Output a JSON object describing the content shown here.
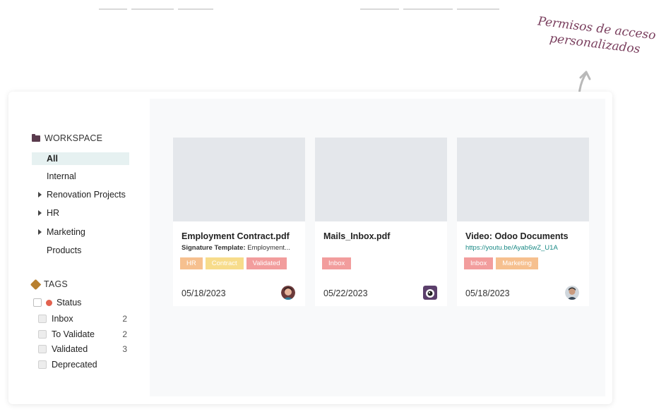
{
  "annotation": {
    "line1": "Permisos de acceso",
    "line2": "personalizados"
  },
  "workspace": {
    "title": "WORKSPACE",
    "items": [
      {
        "label": "All"
      },
      {
        "label": "Internal"
      },
      {
        "label": "Renovation Projects"
      },
      {
        "label": "HR"
      },
      {
        "label": "Marketing"
      },
      {
        "label": "Products"
      }
    ]
  },
  "tags": {
    "title": "TAGS",
    "status_label": "Status",
    "status_color": "#e2624f",
    "items": [
      {
        "label": "Inbox",
        "count": "2"
      },
      {
        "label": "To Validate",
        "count": "2"
      },
      {
        "label": "Validated",
        "count": "3"
      },
      {
        "label": "Deprecated",
        "count": ""
      }
    ]
  },
  "cards": [
    {
      "name": "Employment Contract.pdf",
      "sub_label": "Signature Template:",
      "sub_value": " Employment...",
      "tags": [
        "HR",
        "Contract",
        "Validated"
      ],
      "date": "05/18/2023",
      "avatar": "user-avatar"
    },
    {
      "name": "Mails_Inbox.pdf",
      "tags": [
        "Inbox"
      ],
      "date": "05/22/2023",
      "avatar": "robot-avatar"
    },
    {
      "name": "Video: Odoo Documents",
      "link": "https://youtu.be/Ayab6wZ_U1A",
      "tags": [
        "Inbox",
        "Marketing"
      ],
      "date": "05/18/2023",
      "avatar": "user-avatar"
    }
  ],
  "colors": {
    "accent": "#7a3f5e",
    "active_bg": "#e6f1f1",
    "link": "#1b8a86"
  }
}
